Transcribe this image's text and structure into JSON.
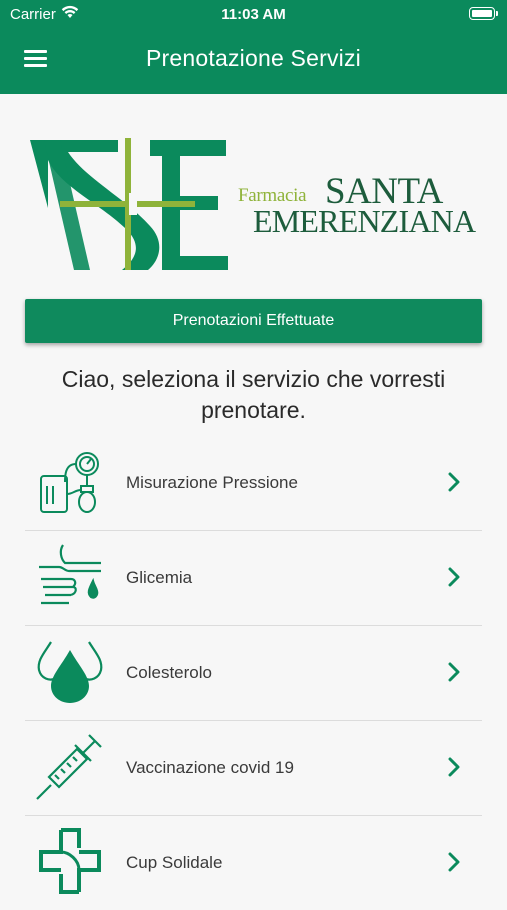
{
  "status_bar": {
    "carrier": "Carrier",
    "time": "11:03 AM"
  },
  "nav": {
    "title": "Prenotazione Servizi",
    "menu_icon": "hamburger-menu-icon"
  },
  "logo": {
    "line1_small": "Farmacia",
    "line1_big": "SANTA",
    "line2": "EMERENZIANA"
  },
  "primary_button": {
    "label": "Prenotazioni Effettuate"
  },
  "greeting": "Ciao, seleziona il servizio che vorresti prenotare.",
  "services": [
    {
      "label": "Misurazione Pressione",
      "icon": "blood-pressure-icon"
    },
    {
      "label": "Glicemia",
      "icon": "glucose-finger-icon"
    },
    {
      "label": "Colesterolo",
      "icon": "drops-icon"
    },
    {
      "label": "Vaccinazione covid 19",
      "icon": "syringe-icon"
    },
    {
      "label": "Cup Solidale",
      "icon": "cup-cross-icon"
    }
  ],
  "colors": {
    "brand": "#0b8a5c",
    "accent": "#8fb33a",
    "logo_dark": "#1d5c3c"
  }
}
